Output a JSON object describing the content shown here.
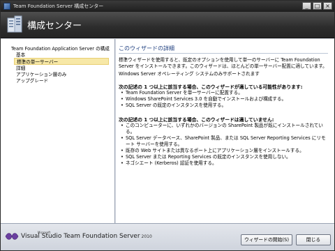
{
  "window": {
    "title": "Team Foundation Server 構成センター",
    "controls": {
      "minimize": "_",
      "maximize": "□",
      "close": "×"
    }
  },
  "header": {
    "title": "構成センター",
    "icon": "configuration-center-icon"
  },
  "nav": {
    "root": "Team Foundation Application Server の構成",
    "items": [
      {
        "label": "基本",
        "selected": false
      },
      {
        "label": "標準の単一サーバー",
        "selected": true
      },
      {
        "label": "詳細",
        "selected": false
      },
      {
        "label": "アプリケーション層のみ",
        "selected": false
      },
      {
        "label": "アップグレード",
        "selected": false
      }
    ]
  },
  "content": {
    "title": "このウィザードの詳細",
    "intro": "標準ウィザードを使用すると、既定のオプションを使用して単一のサーバーに Team Foundation Server をインストールできます。このウィザードは、ほとんどの単一サーバー配置に適しています。",
    "os_note": "Windows Server オペレーティング システムのみサポートされます",
    "applicable_title": "次の記述の 1 つ以上に該当する場合、このウィザードが適している可能性があります:",
    "applicable": [
      "Team Foundation Server を単一サーバーに配置する。",
      "Windows SharePoint Services 3.0 を自動でインストールおよび構成する。",
      "SQL Server の既定のインスタンスを使用する。"
    ],
    "not_applicable_title": "次の記述の 1 つ以上に該当する場合、このウィザードは適していません:",
    "not_applicable": [
      "このコンピューターに、いずれかのバージョンの SharePoint 製品が既にインストールされている。",
      "SQL Server データベース、SharePoint 製品、または SQL Server Reporting Services にリモート サーバーを使用する。",
      "既存の Web サイトまたは異なるポート上にアプリケーション層をインストールする。",
      "SQL Server または Reporting Services の既定のインスタンスを使用しない。",
      "ネゴシエート (Kerberos) 認証を使用する。"
    ]
  },
  "footer": {
    "logo_ms": "Microsoft",
    "logo_text": "Visual Studio Team Foundation Server",
    "logo_year": "2010",
    "start_button": "ウィザードの開始(S)",
    "close_button": "閉じる"
  }
}
